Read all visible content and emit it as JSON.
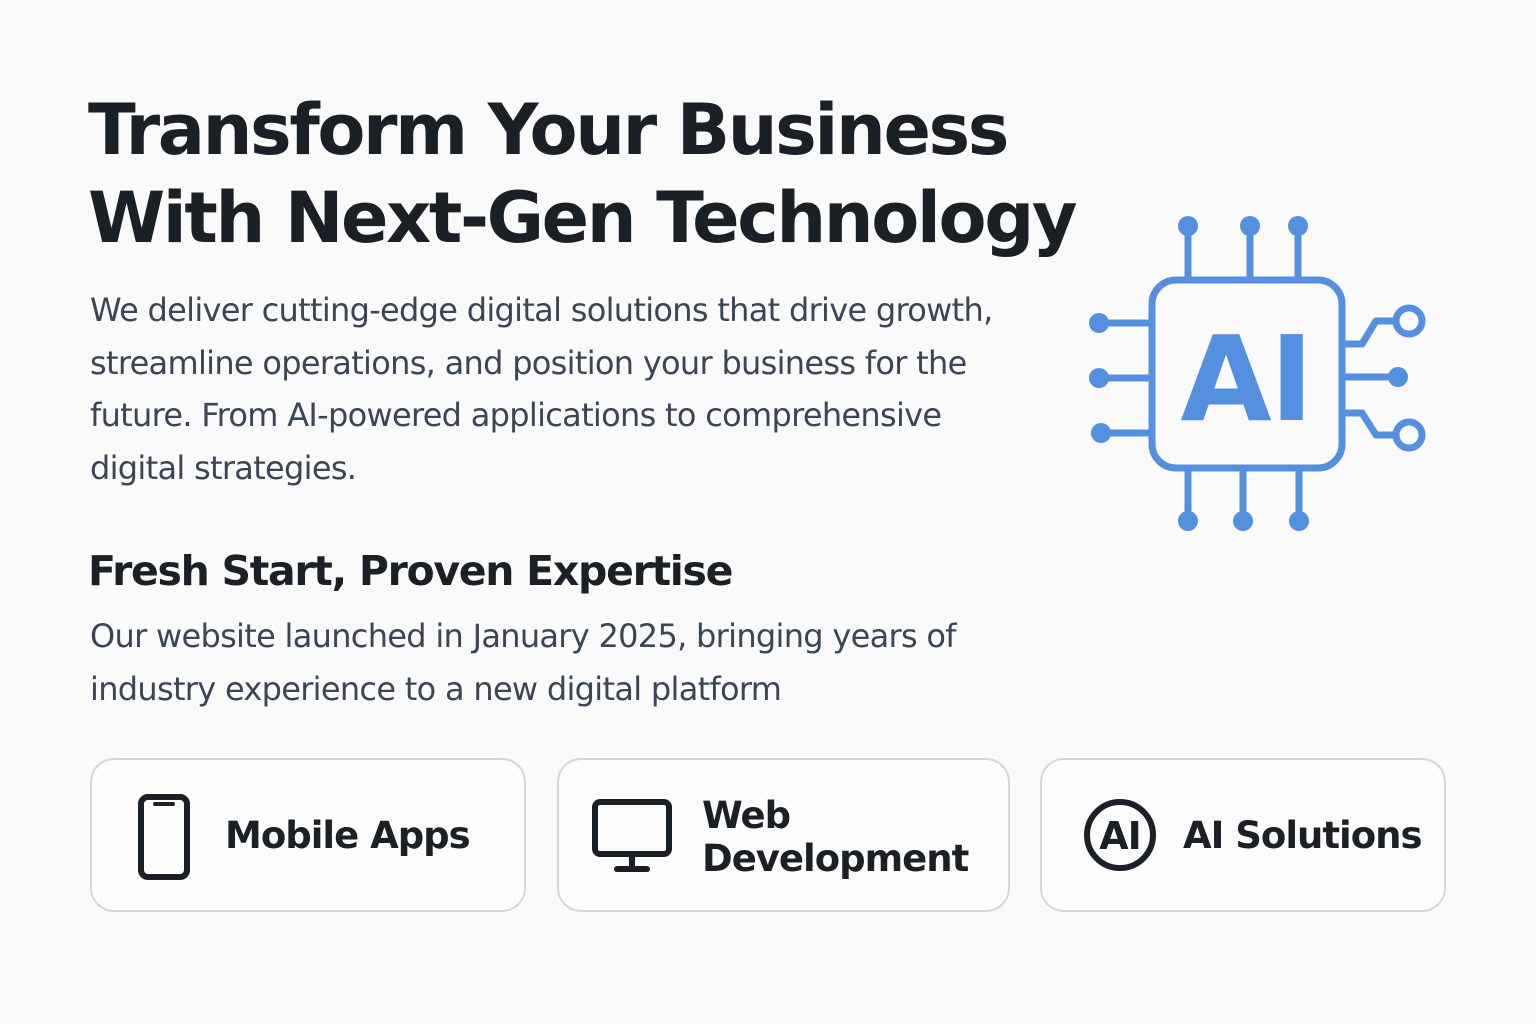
{
  "hero": {
    "title_line1": "Transform Your Business",
    "title_line2": "With Next-Gen Technology",
    "desc_line1": "We deliver cutting-edge digital solutions that drive growth,",
    "desc_line2": "streamline operations, and position your business for the",
    "desc_line3": "future. From AI-powered applications to comprehensive",
    "desc_line4": "digital strategies."
  },
  "about": {
    "heading": "Fresh Start, Proven Expertise",
    "desc_line1": "Our website launched in January 2025, bringing years of",
    "desc_line2": "industry experience to a new digital platform"
  },
  "illustration": {
    "chip_text": "AI",
    "icon": "ai-chip-icon",
    "color": "#5590e0"
  },
  "services": {
    "mobile": {
      "label": "Mobile Apps",
      "icon": "smartphone-icon"
    },
    "web": {
      "label_line1": "Web",
      "label_line2": "Development",
      "icon": "monitor-icon"
    },
    "ai": {
      "label": "AI Solutions",
      "icon_text": "AI",
      "icon": "ai-circle-icon"
    }
  },
  "colors": {
    "heading": "#1b2027",
    "body_text": "#3a4656",
    "accent": "#5590e0",
    "card_border": "#d3d7dd",
    "background": "#fafafa"
  }
}
